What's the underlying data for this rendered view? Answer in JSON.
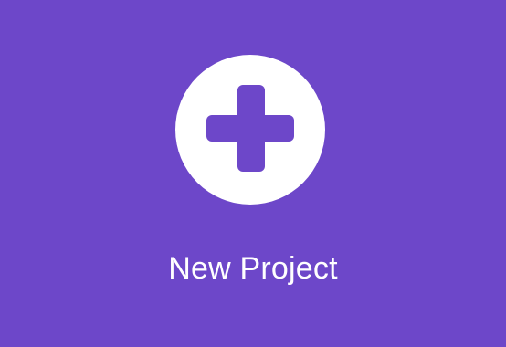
{
  "new_project": {
    "label": "New Project",
    "icon": "plus-icon"
  },
  "colors": {
    "background": "#6d47c9",
    "circle": "#ffffff",
    "plus": "#6d47c9",
    "text": "#ffffff"
  }
}
